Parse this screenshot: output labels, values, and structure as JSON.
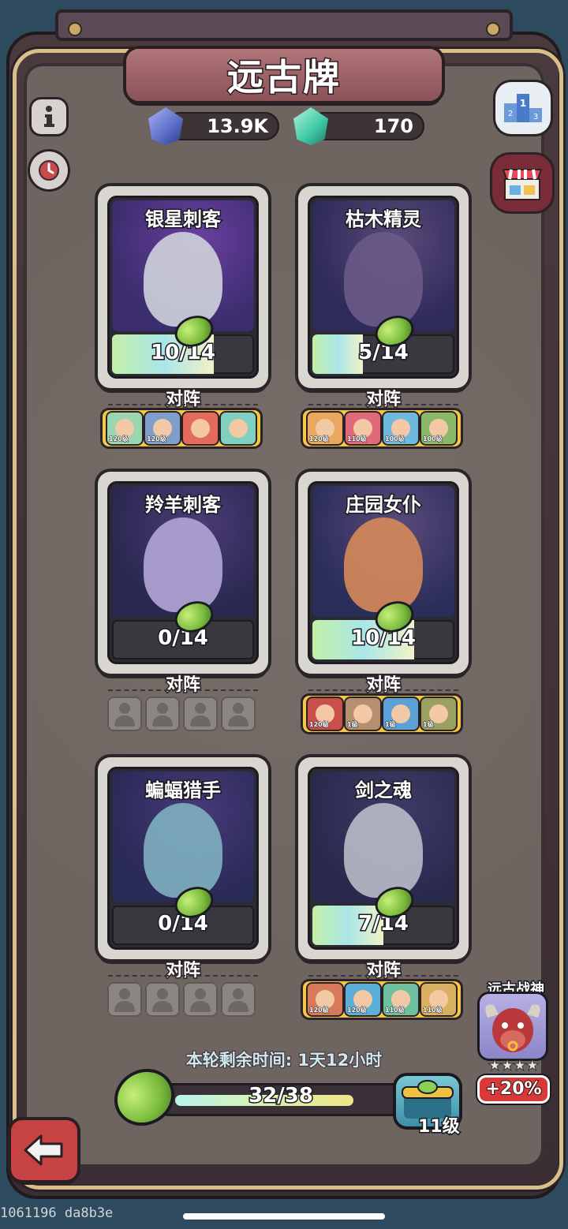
{
  "header": {
    "title": "远古牌",
    "currency_primary": "13.9K",
    "currency_secondary": "170"
  },
  "cards": [
    {
      "name": "银星刺客",
      "progress_text": "10/14",
      "progress_fraction": 0.714,
      "lineup_label": "对阵",
      "lineup": [
        {
          "level": "120级",
          "color": "#9ad6b0"
        },
        {
          "level": "120级",
          "color": "#7f9ec9"
        },
        {
          "level": "",
          "color": "#e26b5b"
        },
        {
          "level": "",
          "color": "#7fd0c0"
        }
      ]
    },
    {
      "name": "枯木精灵",
      "progress_text": "5/14",
      "progress_fraction": 0.357,
      "lineup_label": "对阵",
      "lineup": [
        {
          "level": "120级",
          "color": "#e8a860"
        },
        {
          "level": "110级",
          "color": "#e06a7a"
        },
        {
          "level": "100级",
          "color": "#6fb8e0"
        },
        {
          "level": "100级",
          "color": "#8ab868"
        }
      ]
    },
    {
      "name": "羚羊刺客",
      "progress_text": "0/14",
      "progress_fraction": 0.0,
      "lineup_label": "对阵",
      "lineup": []
    },
    {
      "name": "庄园女仆",
      "progress_text": "10/14",
      "progress_fraction": 0.714,
      "lineup_label": "对阵",
      "lineup": [
        {
          "level": "120级",
          "color": "#c9504a"
        },
        {
          "level": "1级",
          "color": "#b49070"
        },
        {
          "level": "1级",
          "color": "#5ca0d8"
        },
        {
          "level": "1级",
          "color": "#9aa060"
        }
      ]
    },
    {
      "name": "蝙蝠猎手",
      "progress_text": "0/14",
      "progress_fraction": 0.0,
      "lineup_label": "对阵",
      "lineup": []
    },
    {
      "name": "剑之魂",
      "progress_text": "7/14",
      "progress_fraction": 0.5,
      "lineup_label": "对阵",
      "lineup": [
        {
          "level": "120级",
          "color": "#d87a5a"
        },
        {
          "level": "120级",
          "color": "#5ab0d8"
        },
        {
          "level": "110级",
          "color": "#6cc0a0"
        },
        {
          "level": "110级",
          "color": "#d8b060"
        }
      ]
    }
  ],
  "footer": {
    "timer_text": "本轮剩余时间: 1天12小时",
    "progress_text": "32/38",
    "progress_fraction": 0.842,
    "chest_level": "11级"
  },
  "bonus": {
    "title": "远古战神",
    "stars": "★★★★",
    "percent": "+20%"
  },
  "watermark": "1061196 da8b3e",
  "colors": {
    "panel": "#6f6560",
    "card_frame": "#d9d6d2",
    "lineup_bg": "#f3c747",
    "bonus_red": "#d83a3a"
  }
}
